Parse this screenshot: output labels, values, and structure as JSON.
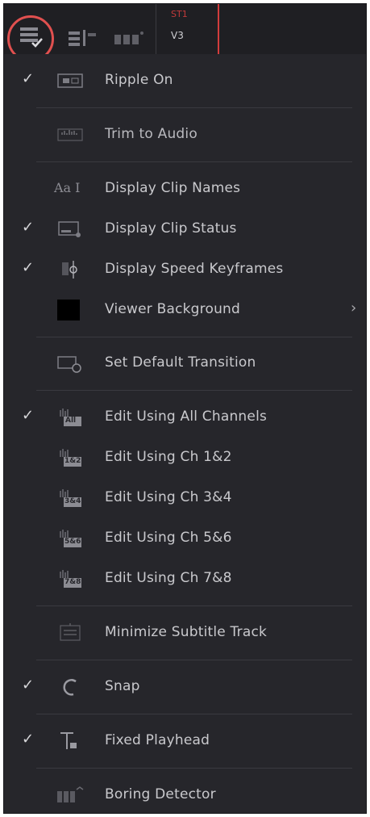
{
  "toolbar": {
    "track_header": {
      "code": "ST1",
      "name": "V3"
    }
  },
  "menu": {
    "items": [
      {
        "label": "Ripple On",
        "checked": "✓",
        "icon": "ripple-icon"
      },
      {
        "label": "Trim to Audio",
        "checked": "",
        "icon": "trim-audio-icon"
      },
      {
        "label": "Display Clip Names",
        "checked": "",
        "icon": "clip-names-icon",
        "icon_text": "Aa"
      },
      {
        "label": "Display Clip Status",
        "checked": "✓",
        "icon": "clip-status-icon"
      },
      {
        "label": "Display Speed Keyframes",
        "checked": "✓",
        "icon": "speed-keyframes-icon"
      },
      {
        "label": "Viewer Background",
        "checked": "",
        "icon": "viewer-background-swatch",
        "submenu": "›",
        "swatch_color": "#000000"
      },
      {
        "label": "Set Default Transition",
        "checked": "",
        "icon": "default-transition-icon"
      },
      {
        "label": "Edit Using All Channels",
        "checked": "✓",
        "icon": "all-channels-icon",
        "icon_text": "All"
      },
      {
        "label": "Edit Using Ch 1&2",
        "checked": "",
        "icon": "channel-1-2-icon",
        "icon_text": "1&2"
      },
      {
        "label": "Edit Using Ch 3&4",
        "checked": "",
        "icon": "channel-3-4-icon",
        "icon_text": "3&4"
      },
      {
        "label": "Edit Using Ch 5&6",
        "checked": "",
        "icon": "channel-5-6-icon",
        "icon_text": "5&6"
      },
      {
        "label": "Edit Using Ch 7&8",
        "checked": "",
        "icon": "channel-7-8-icon",
        "icon_text": "7&8"
      },
      {
        "label": "Minimize Subtitle Track",
        "checked": "",
        "icon": "subtitle-track-icon"
      },
      {
        "label": "Snap",
        "checked": "✓",
        "icon": "snap-icon"
      },
      {
        "label": "Fixed Playhead",
        "checked": "✓",
        "icon": "fixed-playhead-icon"
      },
      {
        "label": "Boring Detector",
        "checked": "",
        "icon": "boring-detector-icon"
      }
    ]
  },
  "colors": {
    "highlight_ring": "#e0504f",
    "playhead": "#d33c3c",
    "menu_bg": "#26262b",
    "text": "#c9c9cd"
  }
}
